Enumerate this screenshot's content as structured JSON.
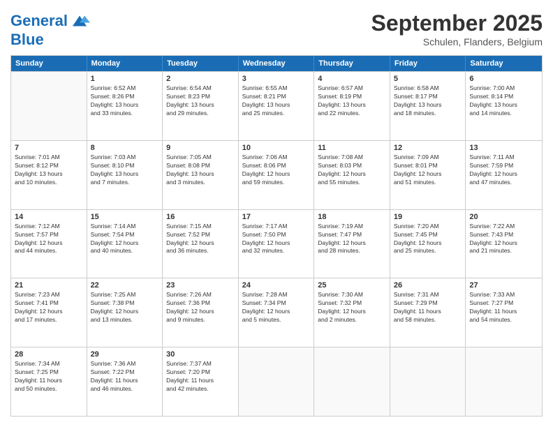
{
  "logo": {
    "line1": "General",
    "line2": "Blue"
  },
  "title": "September 2025",
  "subtitle": "Schulen, Flanders, Belgium",
  "header_days": [
    "Sunday",
    "Monday",
    "Tuesday",
    "Wednesday",
    "Thursday",
    "Friday",
    "Saturday"
  ],
  "weeks": [
    [
      {
        "day": "",
        "info": ""
      },
      {
        "day": "1",
        "info": "Sunrise: 6:52 AM\nSunset: 8:26 PM\nDaylight: 13 hours\nand 33 minutes."
      },
      {
        "day": "2",
        "info": "Sunrise: 6:54 AM\nSunset: 8:23 PM\nDaylight: 13 hours\nand 29 minutes."
      },
      {
        "day": "3",
        "info": "Sunrise: 6:55 AM\nSunset: 8:21 PM\nDaylight: 13 hours\nand 25 minutes."
      },
      {
        "day": "4",
        "info": "Sunrise: 6:57 AM\nSunset: 8:19 PM\nDaylight: 13 hours\nand 22 minutes."
      },
      {
        "day": "5",
        "info": "Sunrise: 6:58 AM\nSunset: 8:17 PM\nDaylight: 13 hours\nand 18 minutes."
      },
      {
        "day": "6",
        "info": "Sunrise: 7:00 AM\nSunset: 8:14 PM\nDaylight: 13 hours\nand 14 minutes."
      }
    ],
    [
      {
        "day": "7",
        "info": "Sunrise: 7:01 AM\nSunset: 8:12 PM\nDaylight: 13 hours\nand 10 minutes."
      },
      {
        "day": "8",
        "info": "Sunrise: 7:03 AM\nSunset: 8:10 PM\nDaylight: 13 hours\nand 7 minutes."
      },
      {
        "day": "9",
        "info": "Sunrise: 7:05 AM\nSunset: 8:08 PM\nDaylight: 13 hours\nand 3 minutes."
      },
      {
        "day": "10",
        "info": "Sunrise: 7:06 AM\nSunset: 8:06 PM\nDaylight: 12 hours\nand 59 minutes."
      },
      {
        "day": "11",
        "info": "Sunrise: 7:08 AM\nSunset: 8:03 PM\nDaylight: 12 hours\nand 55 minutes."
      },
      {
        "day": "12",
        "info": "Sunrise: 7:09 AM\nSunset: 8:01 PM\nDaylight: 12 hours\nand 51 minutes."
      },
      {
        "day": "13",
        "info": "Sunrise: 7:11 AM\nSunset: 7:59 PM\nDaylight: 12 hours\nand 47 minutes."
      }
    ],
    [
      {
        "day": "14",
        "info": "Sunrise: 7:12 AM\nSunset: 7:57 PM\nDaylight: 12 hours\nand 44 minutes."
      },
      {
        "day": "15",
        "info": "Sunrise: 7:14 AM\nSunset: 7:54 PM\nDaylight: 12 hours\nand 40 minutes."
      },
      {
        "day": "16",
        "info": "Sunrise: 7:15 AM\nSunset: 7:52 PM\nDaylight: 12 hours\nand 36 minutes."
      },
      {
        "day": "17",
        "info": "Sunrise: 7:17 AM\nSunset: 7:50 PM\nDaylight: 12 hours\nand 32 minutes."
      },
      {
        "day": "18",
        "info": "Sunrise: 7:19 AM\nSunset: 7:47 PM\nDaylight: 12 hours\nand 28 minutes."
      },
      {
        "day": "19",
        "info": "Sunrise: 7:20 AM\nSunset: 7:45 PM\nDaylight: 12 hours\nand 25 minutes."
      },
      {
        "day": "20",
        "info": "Sunrise: 7:22 AM\nSunset: 7:43 PM\nDaylight: 12 hours\nand 21 minutes."
      }
    ],
    [
      {
        "day": "21",
        "info": "Sunrise: 7:23 AM\nSunset: 7:41 PM\nDaylight: 12 hours\nand 17 minutes."
      },
      {
        "day": "22",
        "info": "Sunrise: 7:25 AM\nSunset: 7:38 PM\nDaylight: 12 hours\nand 13 minutes."
      },
      {
        "day": "23",
        "info": "Sunrise: 7:26 AM\nSunset: 7:36 PM\nDaylight: 12 hours\nand 9 minutes."
      },
      {
        "day": "24",
        "info": "Sunrise: 7:28 AM\nSunset: 7:34 PM\nDaylight: 12 hours\nand 5 minutes."
      },
      {
        "day": "25",
        "info": "Sunrise: 7:30 AM\nSunset: 7:32 PM\nDaylight: 12 hours\nand 2 minutes."
      },
      {
        "day": "26",
        "info": "Sunrise: 7:31 AM\nSunset: 7:29 PM\nDaylight: 11 hours\nand 58 minutes."
      },
      {
        "day": "27",
        "info": "Sunrise: 7:33 AM\nSunset: 7:27 PM\nDaylight: 11 hours\nand 54 minutes."
      }
    ],
    [
      {
        "day": "28",
        "info": "Sunrise: 7:34 AM\nSunset: 7:25 PM\nDaylight: 11 hours\nand 50 minutes."
      },
      {
        "day": "29",
        "info": "Sunrise: 7:36 AM\nSunset: 7:22 PM\nDaylight: 11 hours\nand 46 minutes."
      },
      {
        "day": "30",
        "info": "Sunrise: 7:37 AM\nSunset: 7:20 PM\nDaylight: 11 hours\nand 42 minutes."
      },
      {
        "day": "",
        "info": ""
      },
      {
        "day": "",
        "info": ""
      },
      {
        "day": "",
        "info": ""
      },
      {
        "day": "",
        "info": ""
      }
    ]
  ]
}
